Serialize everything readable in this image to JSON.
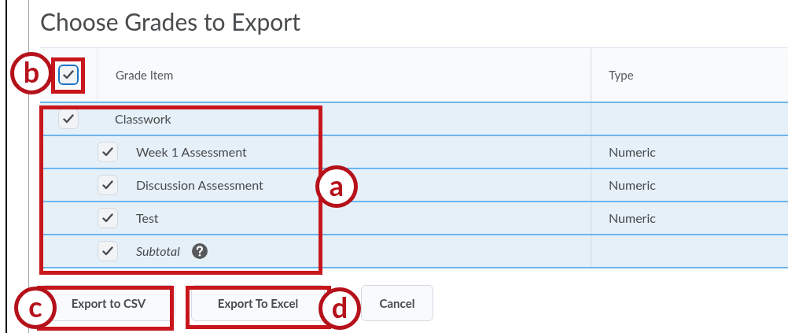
{
  "title": "Choose Grades to Export",
  "table": {
    "select_all": {
      "checked": true
    },
    "columns": [
      "Grade Item",
      "Type"
    ],
    "rows": [
      {
        "kind": "category",
        "name": "Classwork",
        "checked": true,
        "children": [
          {
            "kind": "item",
            "name": "Week 1 Assessment",
            "type": "Numeric",
            "checked": true
          },
          {
            "kind": "item",
            "name": "Discussion Assessment",
            "type": "Numeric",
            "checked": true
          },
          {
            "kind": "item",
            "name": "Test",
            "type": "Numeric",
            "checked": true
          },
          {
            "kind": "subtotal",
            "name": "Subtotal",
            "checked": true
          }
        ]
      }
    ]
  },
  "buttons": [
    "Export to CSV",
    "Export To Excel",
    "Cancel"
  ],
  "annotations": [
    {
      "label": "b"
    },
    {
      "label": "a"
    },
    {
      "label": "c"
    },
    {
      "label": "d"
    }
  ]
}
